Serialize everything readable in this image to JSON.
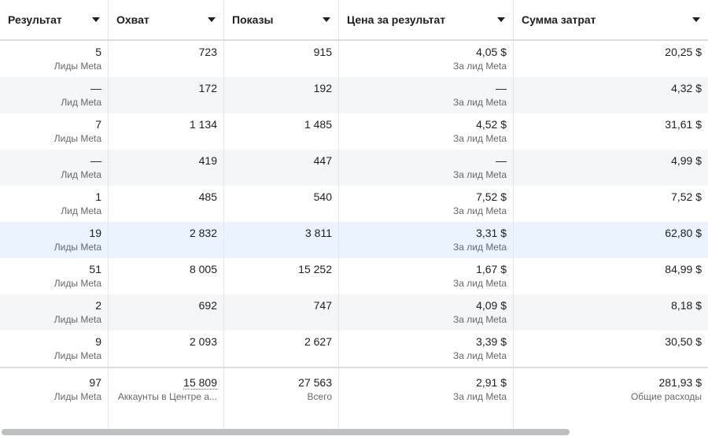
{
  "columns": [
    {
      "label": "Результат"
    },
    {
      "label": "Охват"
    },
    {
      "label": "Показы"
    },
    {
      "label": "Цена за результат"
    },
    {
      "label": "Сумма затрат"
    }
  ],
  "rows": [
    {
      "result": "5",
      "result_sub": "Лиды Meta",
      "reach": "723",
      "impressions": "915",
      "cpr": "4,05 $",
      "cpr_sub": "За лид Meta",
      "spend": "20,25 $"
    },
    {
      "result": "—",
      "result_sub": "Лид Meta",
      "reach": "172",
      "impressions": "192",
      "cpr": "—",
      "cpr_sub": "За лид Meta",
      "spend": "4,32 $"
    },
    {
      "result": "7",
      "result_sub": "Лиды Meta",
      "reach": "1 134",
      "impressions": "1 485",
      "cpr": "4,52 $",
      "cpr_sub": "За лид Meta",
      "spend": "31,61 $"
    },
    {
      "result": "—",
      "result_sub": "Лид Meta",
      "reach": "419",
      "impressions": "447",
      "cpr": "—",
      "cpr_sub": "За лид Meta",
      "spend": "4,99 $"
    },
    {
      "result": "1",
      "result_sub": "Лид Meta",
      "reach": "485",
      "impressions": "540",
      "cpr": "7,52 $",
      "cpr_sub": "За лид Meta",
      "spend": "7,52 $"
    },
    {
      "result": "19",
      "result_sub": "Лиды Meta",
      "reach": "2 832",
      "impressions": "3 811",
      "cpr": "3,31 $",
      "cpr_sub": "За лид Meta",
      "spend": "62,80 $"
    },
    {
      "result": "51",
      "result_sub": "Лиды Meta",
      "reach": "8 005",
      "impressions": "15 252",
      "cpr": "1,67 $",
      "cpr_sub": "За лид Meta",
      "spend": "84,99 $"
    },
    {
      "result": "2",
      "result_sub": "Лиды Meta",
      "reach": "692",
      "impressions": "747",
      "cpr": "4,09 $",
      "cpr_sub": "За лид Meta",
      "spend": "8,18 $"
    },
    {
      "result": "9",
      "result_sub": "Лиды Meta",
      "reach": "2 093",
      "impressions": "2 627",
      "cpr": "3,39 $",
      "cpr_sub": "За лид Meta",
      "spend": "30,50 $"
    }
  ],
  "totals": {
    "result": "97",
    "result_sub": "Лиды Meta",
    "reach": "15 809",
    "reach_sub": "Аккаунты в Центре а...",
    "impressions": "27 563",
    "impressions_sub": "Всего",
    "cpr": "2,91 $",
    "cpr_sub": "За лид Meta",
    "spend": "281,93 $",
    "spend_sub": "Общие расходы"
  }
}
